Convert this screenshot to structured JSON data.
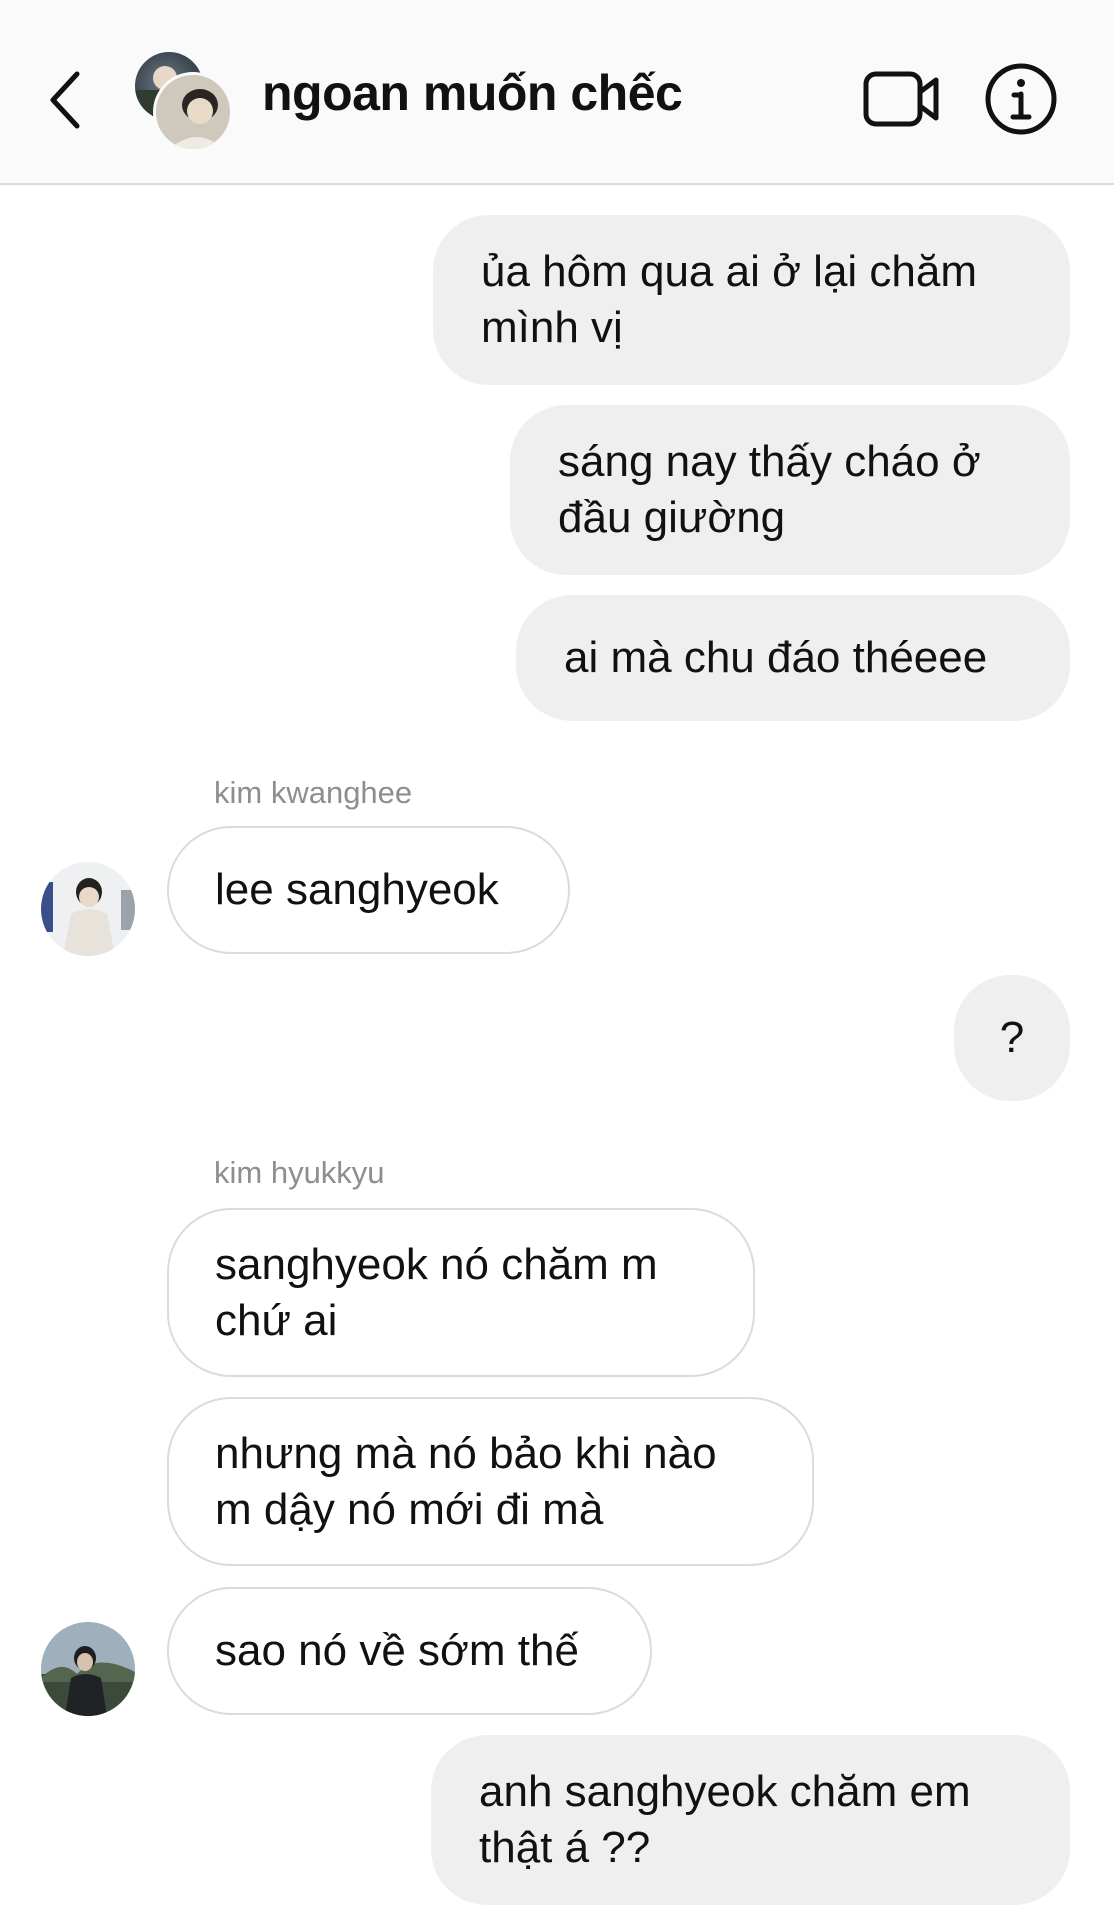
{
  "header": {
    "title": "ngoan muốn chếc",
    "back_icon": "chevron-left-icon",
    "video_icon": "video-camera-icon",
    "info_icon": "info-icon"
  },
  "messages": [
    {
      "direction": "outgoing",
      "text": "ủa hôm qua ai ở lại chăm\nmình vị"
    },
    {
      "direction": "outgoing",
      "text": "sáng nay thấy cháo ở\nđầu giường"
    },
    {
      "direction": "outgoing",
      "text": "ai mà chu đáo théeee"
    },
    {
      "direction": "incoming",
      "sender": "kim kwanghee",
      "text": "lee sanghyeok"
    },
    {
      "direction": "outgoing",
      "text": "?"
    },
    {
      "direction": "incoming",
      "sender": "kim hyukkyu",
      "text": "sanghyeok nó chăm m\nchứ ai"
    },
    {
      "direction": "incoming",
      "text": "nhưng mà nó bảo khi nào\nm dậy nó mới đi mà"
    },
    {
      "direction": "incoming",
      "text": "sao nó về sớm thế"
    },
    {
      "direction": "outgoing",
      "text": "anh sanghyeok chăm em\nthật á ??"
    }
  ],
  "colors": {
    "header_bg": "#fafafa",
    "outgoing_bubble": "#efefef",
    "incoming_border": "#dbdbdb",
    "sender_name": "#8e8e8e"
  }
}
